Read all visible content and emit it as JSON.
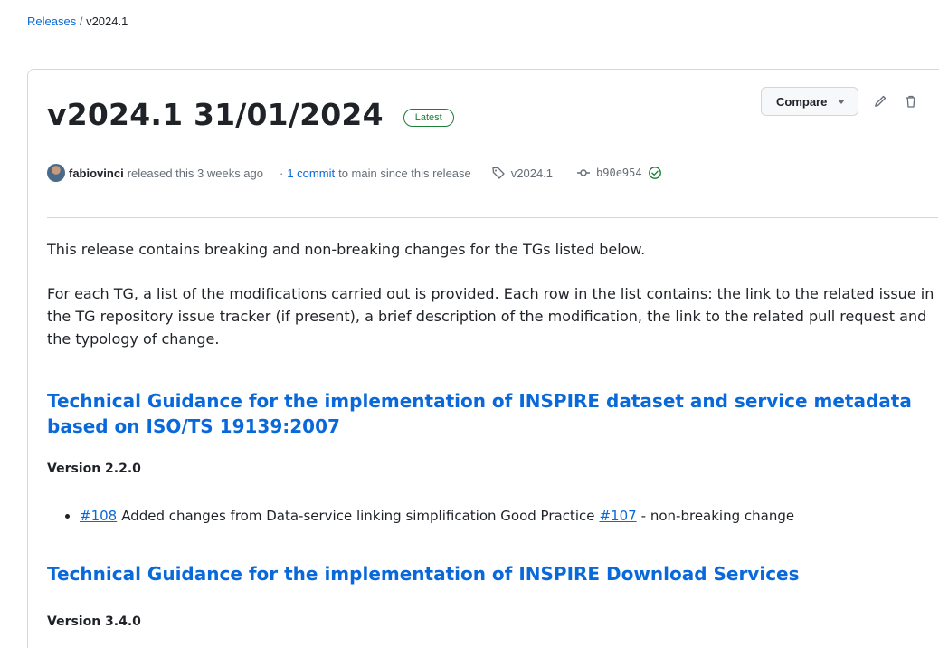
{
  "breadcrumb": {
    "root": "Releases",
    "separator": "/",
    "current": "v2024.1"
  },
  "release": {
    "title": "v2024.1 31/01/2024",
    "badge": "Latest",
    "compare_label": "Compare",
    "author": "fabiovinci",
    "released_text": "released this 3 weeks ago",
    "commit_prefix": "·",
    "commit_link": "1 commit",
    "commit_suffix": "to main since this release",
    "tag": "v2024.1",
    "commit_hash": "b90e954"
  },
  "content": {
    "intro": "This release contains breaking and non-breaking changes for the TGs listed below.",
    "description": "For each TG, a list of the modifications carried out is provided. Each row in the list contains: the link to the related issue in the TG repository issue tracker (if present), a brief description of the modification, the link to the related pull request and the typology of change.",
    "sections": [
      {
        "heading": "Technical Guidance for the implementation of INSPIRE dataset and service metadata based on ISO/TS 19139:2007",
        "version": "Version 2.2.0",
        "items": [
          {
            "issue": "#108",
            "text": "Added changes from Data-service linking simplification Good Practice",
            "pr": "#107",
            "change": "- non-breaking change"
          }
        ]
      },
      {
        "heading": "Technical Guidance for the implementation of INSPIRE Download Services",
        "version": "Version 3.4.0"
      }
    ]
  },
  "colors": {
    "link": "#0969da",
    "latest_green": "#1a7f37",
    "verified_green": "#1a7f37",
    "border": "#d0d7de"
  }
}
